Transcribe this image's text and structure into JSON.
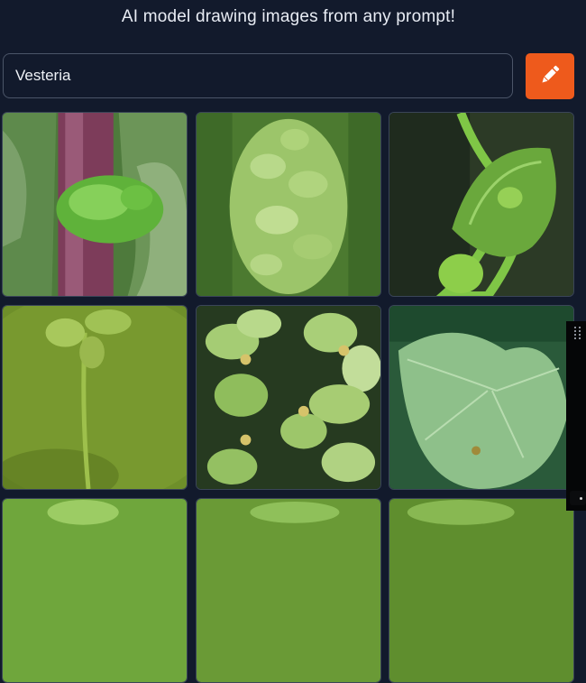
{
  "header": {
    "tagline": "AI model drawing images from any prompt!"
  },
  "prompt": {
    "value": "Vesteria"
  },
  "toolbar": {
    "draw_icon": "pencil-icon",
    "accent": "#ee5a1c"
  },
  "gallery": {
    "images": [
      {
        "subject": "plant-leaf-bud"
      },
      {
        "subject": "green-flower-cluster"
      },
      {
        "subject": "fuzzy-leaf-tendril"
      },
      {
        "subject": "clover-sprout"
      },
      {
        "subject": "euphorbia-leaves"
      },
      {
        "subject": "leaf-closeup"
      },
      {
        "subject": "plant-partial"
      },
      {
        "subject": "plant-partial"
      },
      {
        "subject": "plant-partial"
      }
    ]
  }
}
